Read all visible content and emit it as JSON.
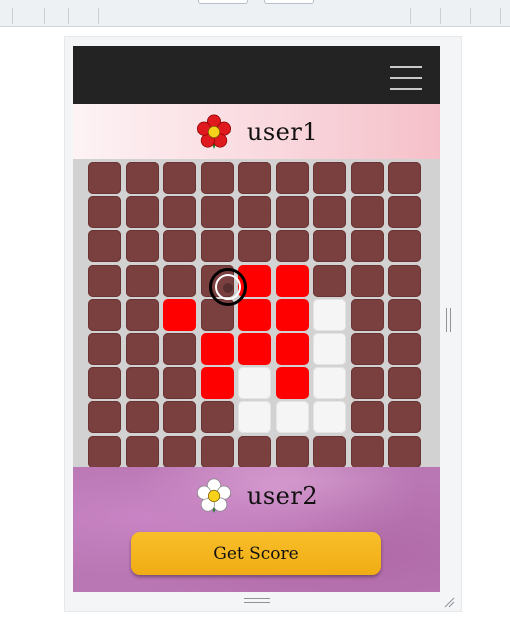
{
  "player1": {
    "name": "user1",
    "flower": "red-flower-icon"
  },
  "player2": {
    "name": "user2",
    "flower": "white-flower-icon"
  },
  "actions": {
    "score_label": "Get Score"
  },
  "colors": {
    "red": "#ff0000",
    "white": "#f5f5f5",
    "empty": "#7a3f3f",
    "button": "#f2b01c"
  },
  "board": {
    "rows": 9,
    "cols": 9,
    "cells": [
      [
        "e",
        "e",
        "e",
        "e",
        "e",
        "e",
        "e",
        "e",
        "e"
      ],
      [
        "e",
        "e",
        "e",
        "e",
        "e",
        "e",
        "e",
        "e",
        "e"
      ],
      [
        "e",
        "e",
        "e",
        "e",
        "e",
        "e",
        "e",
        "e",
        "e"
      ],
      [
        "e",
        "e",
        "e",
        "e",
        "r",
        "r",
        "e",
        "e",
        "e"
      ],
      [
        "e",
        "e",
        "r",
        "e",
        "r",
        "r",
        "w",
        "e",
        "e"
      ],
      [
        "e",
        "e",
        "e",
        "r",
        "r",
        "r",
        "w",
        "e",
        "e"
      ],
      [
        "e",
        "e",
        "e",
        "r",
        "w",
        "r",
        "w",
        "e",
        "e"
      ],
      [
        "e",
        "e",
        "e",
        "e",
        "w",
        "w",
        "w",
        "e",
        "e"
      ],
      [
        "e",
        "e",
        "e",
        "e",
        "e",
        "e",
        "e",
        "e",
        "e"
      ]
    ]
  }
}
